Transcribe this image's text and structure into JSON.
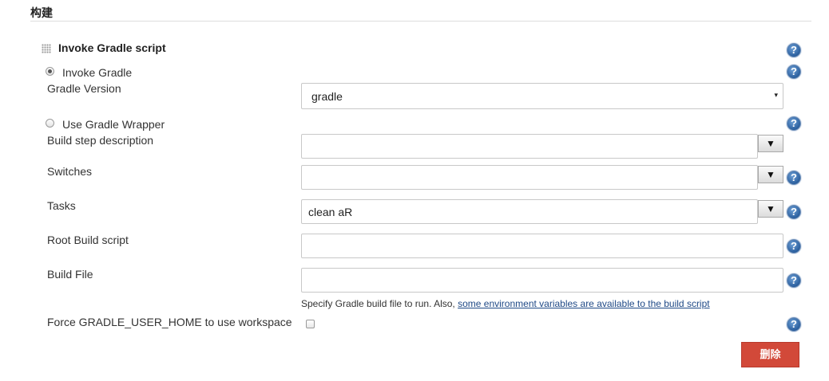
{
  "section": {
    "title": "构建"
  },
  "step": {
    "title": "Invoke Gradle script",
    "invoke_gradle_label": "Invoke Gradle",
    "gradle_version_label": "Gradle Version",
    "gradle_version_value": "gradle",
    "use_wrapper_label": "Use Gradle Wrapper",
    "build_step_description_label": "Build step description",
    "build_step_description_value": "",
    "switches_label": "Switches",
    "switches_value": "",
    "tasks_label": "Tasks",
    "tasks_value": "clean aR",
    "root_build_script_label": "Root Build script",
    "root_build_script_value": "",
    "build_file_label": "Build File",
    "build_file_value": "",
    "build_file_hint_prefix": "Specify Gradle build file to run. Also, ",
    "build_file_hint_link": "some environment variables are available to the build script",
    "force_home_label": "Force GRADLE_USER_HOME to use workspace",
    "expand_glyph": "▼",
    "select_arrow_glyph": "▾",
    "help_glyph": "?"
  },
  "actions": {
    "delete_label": "删除"
  },
  "colors": {
    "delete_bg": "#d24939",
    "help_blue": "#2b5f9e",
    "link": "#204a87"
  }
}
